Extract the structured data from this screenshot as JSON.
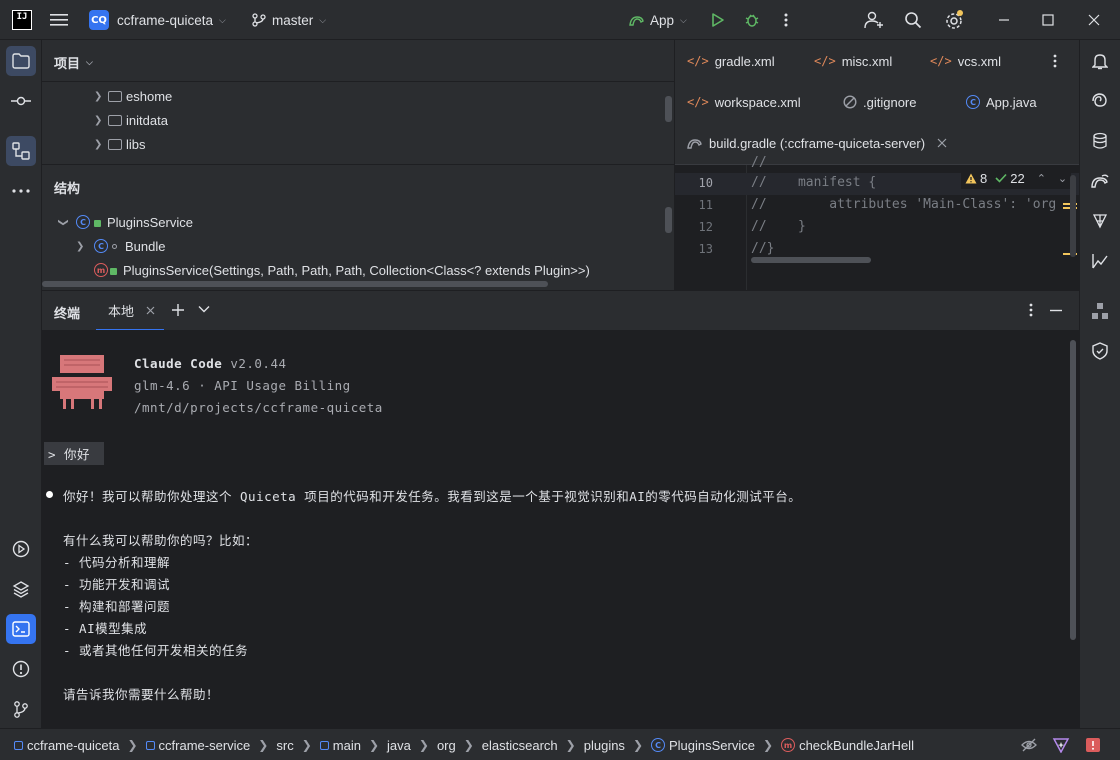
{
  "titlebar": {
    "logo_text": "IJ",
    "project_badge": "CQ",
    "project_name": "ccframe-quiceta",
    "branch": "master",
    "run_config": "App"
  },
  "project_panel": {
    "title": "项目",
    "items": [
      {
        "label": "eshome"
      },
      {
        "label": "initdata"
      },
      {
        "label": "libs"
      }
    ]
  },
  "structure_panel": {
    "title": "结构",
    "items": [
      {
        "label": "PluginsService",
        "kind": "class"
      },
      {
        "label": "Bundle",
        "kind": "class"
      },
      {
        "label": "PluginsService(Settings, Path, Path, Path, Collection<Class<? extends Plugin>>)",
        "kind": "method"
      }
    ]
  },
  "editor": {
    "tabs": [
      {
        "label": "gradle.xml"
      },
      {
        "label": "misc.xml"
      },
      {
        "label": "vcs.xml"
      },
      {
        "label": "workspace.xml"
      },
      {
        "label": ".gitignore"
      },
      {
        "label": "App.java"
      },
      {
        "label": "build.gradle (:ccframe-quiceta-server)"
      }
    ],
    "warnings": "8",
    "checks": "22",
    "lines": [
      {
        "num": "10",
        "text": "//    manifest {"
      },
      {
        "num": "11",
        "text": "//        attributes 'Main-Class': 'org"
      },
      {
        "num": "12",
        "text": "//    }"
      },
      {
        "num": "13",
        "text": "//}"
      }
    ]
  },
  "terminal": {
    "title": "终端",
    "tab_label": "本地",
    "app_name": "Claude Code",
    "version": "v2.0.44",
    "model": "glm-4.6 · API Usage Billing",
    "path": "/mnt/d/projects/ccframe-quiceta",
    "prompt": "> 你好",
    "response_lines": [
      "你好！我可以帮助你处理这个 Quiceta 项目的代码和开发任务。我看到这是一个基于视觉识别和AI的零代码自动化测试平台。",
      "有什么我可以帮助你的吗？比如：",
      "- 代码分析和理解",
      "- 功能开发和调试",
      "- 构建和部署问题",
      "- AI模型集成",
      "- 或者其他任何开发相关的任务",
      "请告诉我你需要什么帮助！"
    ]
  },
  "statusbar": {
    "crumbs": [
      "ccframe-quiceta",
      "ccframe-service",
      "src",
      "main",
      "java",
      "org",
      "elasticsearch",
      "plugins",
      "PluginsService",
      "checkBundleJarHell"
    ]
  },
  "colors": {
    "accent": "#3574f0",
    "background": "#1e1f22",
    "panel": "#2b2d30",
    "run_green": "#5fb865",
    "xml_orange": "#e0895a",
    "error_red": "#db5c5c"
  }
}
